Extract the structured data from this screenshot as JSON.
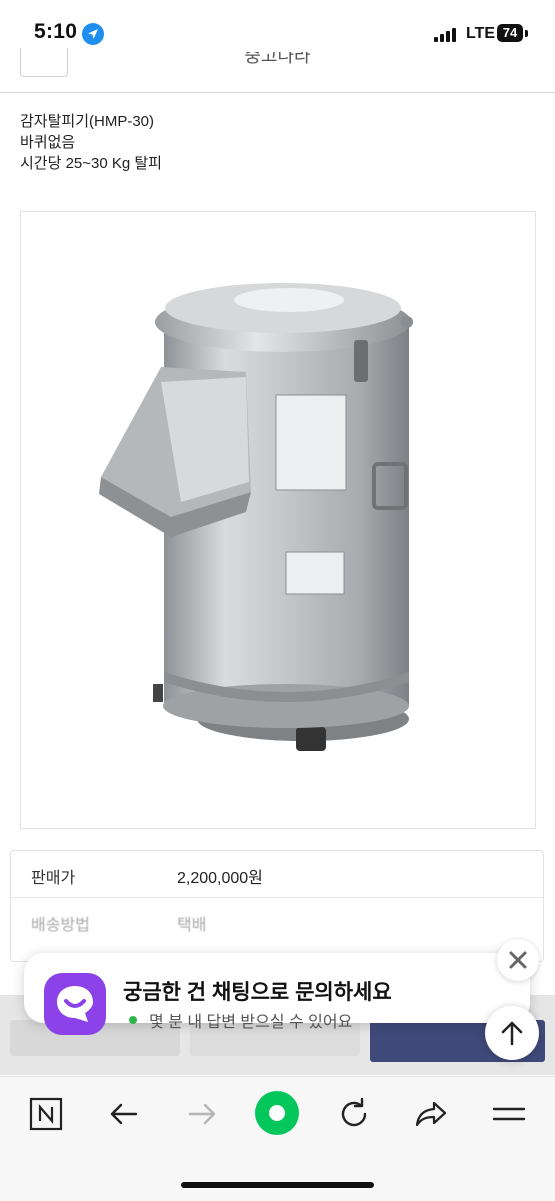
{
  "status_bar": {
    "time": "5:10",
    "network": "LTE",
    "battery": "74"
  },
  "header": {
    "title": "중고나라"
  },
  "product": {
    "description_lines": [
      "감자탈피기(HMP-30)",
      "바퀴없음",
      "시간당 25~30 Kg 탈피"
    ]
  },
  "info_table": {
    "rows": [
      {
        "label": "판매가",
        "value": "2,200,000원"
      },
      {
        "label": "배송방법",
        "value": "택배"
      }
    ]
  },
  "chat_banner": {
    "title": "궁금한 건 채팅으로 문의하세요",
    "subtitle": "몇 분 내 답변 받으실 수 있어요",
    "accent_color": "#8b42e8",
    "status_color": "#2fb64a"
  },
  "browser_toolbar": {
    "items": [
      "naver-home-icon",
      "back-arrow-icon",
      "forward-arrow-icon",
      "green-dot-icon",
      "refresh-icon",
      "share-icon",
      "menu-icon"
    ],
    "accent_color": "#03c75a"
  }
}
